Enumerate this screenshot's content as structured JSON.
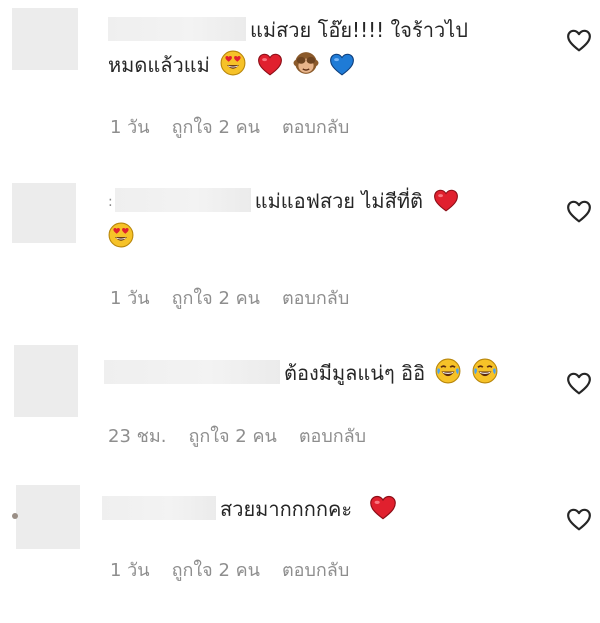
{
  "comments": [
    {
      "text": "แม่สวย โอ๊ย!!!! ใจร้าวไป",
      "text2": "หมดแล้วแม่",
      "time": "1 วัน",
      "likes": "ถูกใจ 2 คน",
      "reply": "ตอบกลับ"
    },
    {
      "text": "แม่แอฟสวย ไม่สีที่ติ",
      "time": "1 วัน",
      "likes": "ถูกใจ 2 คน",
      "reply": "ตอบกลับ"
    },
    {
      "text": "ต้องมีมูลแน่ๆ อิอิ",
      "time": "23 ชม.",
      "likes": "ถูกใจ 2 คน",
      "reply": "ตอบกลับ"
    },
    {
      "text": "สวยมากกกกคะ",
      "time": "1 วัน",
      "likes": "ถูกใจ 2 คน",
      "reply": "ตอบกลับ"
    }
  ],
  "icons": {
    "like": "heart-outline-icon",
    "heart": "red-heart-emoji",
    "blue_heart": "blue-heart-emoji",
    "heart_eyes": "heart-eyes-emoji",
    "monkey": "see-no-evil-monkey-emoji",
    "laugh": "tears-of-joy-emoji"
  },
  "colors": {
    "text": "#262626",
    "meta": "#8e8e8e",
    "placeholder": "#ececec",
    "heart": "#e0202e",
    "blue_heart": "#1f7bd6"
  }
}
